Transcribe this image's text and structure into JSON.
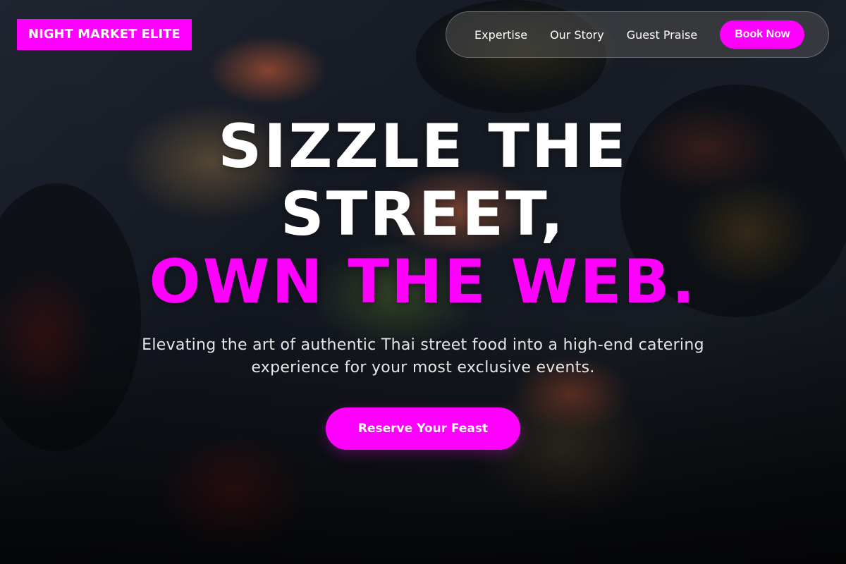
{
  "brand": {
    "logo_text": "NIGHT MARKET ELITE"
  },
  "nav": {
    "items": [
      {
        "label": "Expertise"
      },
      {
        "label": "Our Story"
      },
      {
        "label": "Guest Praise"
      }
    ],
    "book_label": "Book Now"
  },
  "hero": {
    "headline_line1": "SIZZLE THE",
    "headline_line2": "STREET,",
    "headline_line3": "OWN THE WEB.",
    "subtitle": "Elevating the art of authentic Thai street food into a high-end catering experience for your most exclusive events.",
    "cta_label": "Reserve Your Feast"
  },
  "colors": {
    "accent": "#ff00ff",
    "text_primary": "#ffffff",
    "nav_background": "rgba(80,80,80,0.55)"
  }
}
